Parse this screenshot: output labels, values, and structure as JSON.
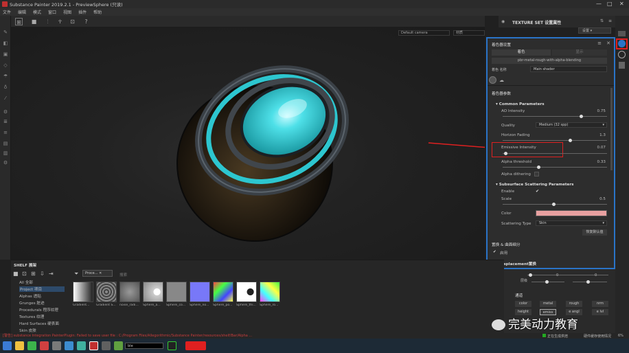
{
  "window": {
    "title": "Substance Painter 2019.2.1 - PreviewSphere (只读)",
    "controls": [
      "—",
      "□",
      "✕"
    ]
  },
  "menu": [
    "文件",
    "编辑",
    "模式",
    "窗口",
    "视图",
    "插件",
    "帮助"
  ],
  "viewport": {
    "camera": "Default camera",
    "mode": "材质"
  },
  "texture_set": {
    "title": "TEXTURE SET 设置属性",
    "settings_label": "设置"
  },
  "shader_panel": {
    "title": "着色器设置",
    "tabs": [
      "着色",
      "显示"
    ],
    "shader_file": "pbr-metal-rough-with-alpha-blending",
    "name_label": "着色 名称",
    "name_value": "Main shader",
    "params_title": "着色器参数",
    "common_title": "Common Parameters",
    "params": [
      {
        "label": "AO Intensity",
        "value": "0.75"
      },
      {
        "label": "Quality",
        "value": "Medium (32 spp)"
      },
      {
        "label": "Horizon Fading",
        "value": "1.3"
      },
      {
        "label": "Emissive Intensity",
        "value": "0.07"
      },
      {
        "label": "Alpha threshold",
        "value": "0.33"
      },
      {
        "label": "Alpha dithering",
        "value": ""
      }
    ],
    "sss_title": "Subsurface Scattering Parameters",
    "sss": [
      {
        "label": "Enable",
        "value": "✔"
      },
      {
        "label": "Scale",
        "value": "0.5"
      },
      {
        "label": "Color",
        "value": ""
      },
      {
        "label": "Scattering Type",
        "value": "Skin"
      }
    ],
    "reset_label": "恢复默认值",
    "displacement_title": "置换 & 曲面细分",
    "displacement_enable": "启用",
    "displacement_sub": "Displacement置换"
  },
  "shelf": {
    "title": "SHELF 展架",
    "categories": [
      "All 全部",
      "Project 项目",
      "Alphas 透贴",
      "Grunges 脏迹",
      "Procedurals 程序纹理",
      "Textures 纹理",
      "Hard Surfaces 硬表面",
      "Skin 皮肤"
    ],
    "search_tag": "Proce...",
    "search_placeholder": "搜索",
    "thumbnails": [
      "Gradient...",
      "Gradient S...",
      "noise_radi...",
      "Sphere_a...",
      "Sphere_co...",
      "Sphere_no...",
      "Sphere_po...",
      "Sphere_thi...",
      "Sphere_ro..."
    ]
  },
  "channels": {
    "title": "通道",
    "buttons": [
      "color",
      "metal",
      "rough",
      "nrm",
      "height",
      "emiss",
      "e angl",
      "e lvl"
    ]
  },
  "lower_right": {
    "label1": "层级",
    "val1": "0",
    "val2": "0"
  },
  "status": "[警告] substance Integration PainterPlugin: Failed to save user file : C:/Program Files/Allegorithmic/Substance Painter/resources/shelf/Bar/Alpha ...",
  "taskbar": {
    "bake_label": "正在生成烘焙",
    "cache_label": "硬件缓存使用情况",
    "memory_label": "6%",
    "search_text": "ble"
  },
  "watermark": "完美动力教育",
  "colors": {
    "accent_blue": "#2a74c8",
    "highlight_red": "#e02020",
    "sss_color": "#e8a0a0",
    "sphere_cyan": "#3ad0d8"
  }
}
